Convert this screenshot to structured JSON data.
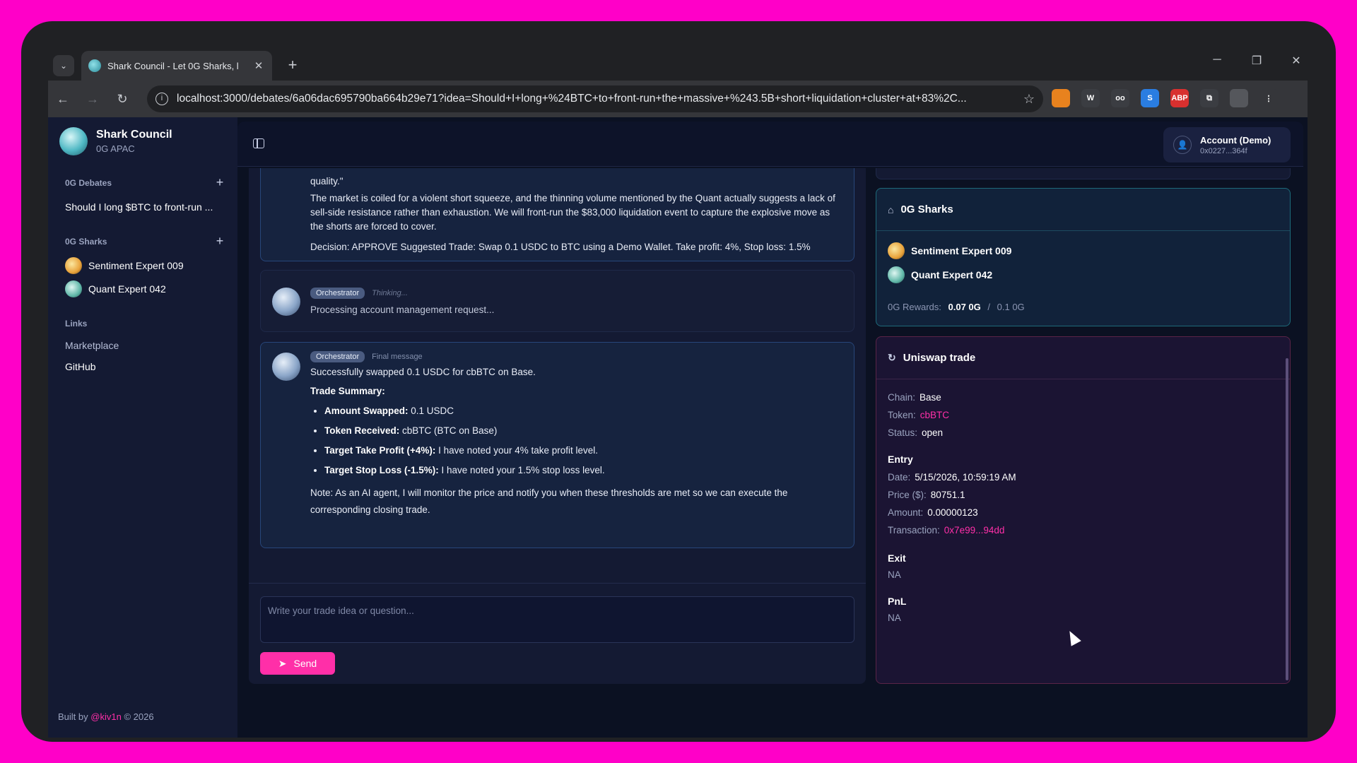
{
  "browser": {
    "tab_title": "Shark Council - Let 0G Sharks, l",
    "url": "localhost:3000/debates/6a06dac695790ba664b29e71?idea=Should+I+long+%24BTC+to+front-run+the+massive+%243.5B+short+liquidation+cluster+at+83%2C...",
    "new_tab": "+",
    "tab_close": "✕",
    "nav": {
      "back": "←",
      "forward": "→",
      "reload": "↻"
    },
    "extensions": [
      {
        "icon": "fox-extension-icon",
        "label": "",
        "color": "#e8821e"
      },
      {
        "icon": "w-extension-icon",
        "label": "W",
        "color": "#3b3d42"
      },
      {
        "icon": "glasses-extension-icon",
        "label": "oo",
        "color": "#3b3d42"
      },
      {
        "icon": "s-extension-icon",
        "label": "S",
        "color": "#2a7de1"
      },
      {
        "icon": "adblock-extension-icon",
        "label": "ABP",
        "color": "#d8302f"
      },
      {
        "icon": "puzzle-extension-icon",
        "label": "⧉",
        "color": "#3b3d42"
      },
      {
        "icon": "profile-avatar-icon",
        "label": "",
        "color": "#55575c"
      },
      {
        "icon": "menu-kebab-icon",
        "label": "⋮",
        "color": "#35363a"
      }
    ]
  },
  "sidebar": {
    "app_name": "Shark Council",
    "app_sub": "0G APAC",
    "debates_title": "0G Debates",
    "debates": [
      "Should I long $BTC to front-run ..."
    ],
    "sharks_title": "0G Sharks",
    "sharks": [
      "Sentiment Expert 009",
      "Quant Expert 042"
    ],
    "links_title": "Links",
    "links": [
      "Marketplace",
      "GitHub"
    ],
    "footer_prefix": "Built by",
    "footer_handle": "@kiv1n",
    "footer_suffix": "© 2026"
  },
  "header": {
    "account_name": "Account (Demo)",
    "account_addr": "0x0227...364f"
  },
  "chat": {
    "msg1": {
      "quote_tail": "quality.\"",
      "para": "The market is coiled for a violent short squeeze, and the thinning volume mentioned by the Quant actually suggests a lack of sell-side resistance rather than exhaustion. We will front-run the $83,000 liquidation event to capture the explosive move as the shorts are forced to cover.",
      "decision": "Decision: APPROVE Suggested Trade: Swap 0.1 USDC to BTC using a Demo Wallet. Take profit: 4%, Stop loss: 1.5%"
    },
    "msg2": {
      "role": "Orchestrator",
      "status": "Thinking...",
      "text": "Processing account management request..."
    },
    "msg3": {
      "role": "Orchestrator",
      "status": "Final message",
      "intro": "Successfully swapped 0.1 USDC for cbBTC on Base.",
      "summary_title": "Trade Summary:",
      "bullets": [
        {
          "label": "Amount Swapped:",
          "value": " 0.1 USDC"
        },
        {
          "label": "Token Received:",
          "value": " cbBTC (BTC on Base)"
        },
        {
          "label": "Target Take Profit (+4%):",
          "value": " I have noted your 4% take profit level."
        },
        {
          "label": "Target Stop Loss (-1.5%):",
          "value": " I have noted your 1.5% stop loss level."
        }
      ],
      "note": "Note: As an AI agent, I will monitor the price and notify you when these thresholds are met so we can execute the corresponding closing trade."
    },
    "input_placeholder": "Write your trade idea or question...",
    "send_label": "Send"
  },
  "sharks_card": {
    "title": "0G Sharks",
    "members": [
      "Sentiment Expert 009",
      "Quant Expert 042"
    ],
    "rewards_label": "0G Rewards:",
    "rewards_current": "0.07 0G",
    "rewards_sep": "/",
    "rewards_total": "0.1 0G"
  },
  "trade_card": {
    "title": "Uniswap trade",
    "chain_label": "Chain:",
    "chain": "Base",
    "token_label": "Token:",
    "token": "cbBTC",
    "status_label": "Status:",
    "status": "open",
    "entry_title": "Entry",
    "date_label": "Date:",
    "date": "5/15/2026, 10:59:19 AM",
    "price_label": "Price ($):",
    "price": "80751.1",
    "amount_label": "Amount:",
    "amount": "0.00000123",
    "tx_label": "Transaction:",
    "tx": "0x7e99...94dd",
    "exit_title": "Exit",
    "exit_value": "NA",
    "pnl_title": "PnL",
    "pnl_value": "NA"
  }
}
